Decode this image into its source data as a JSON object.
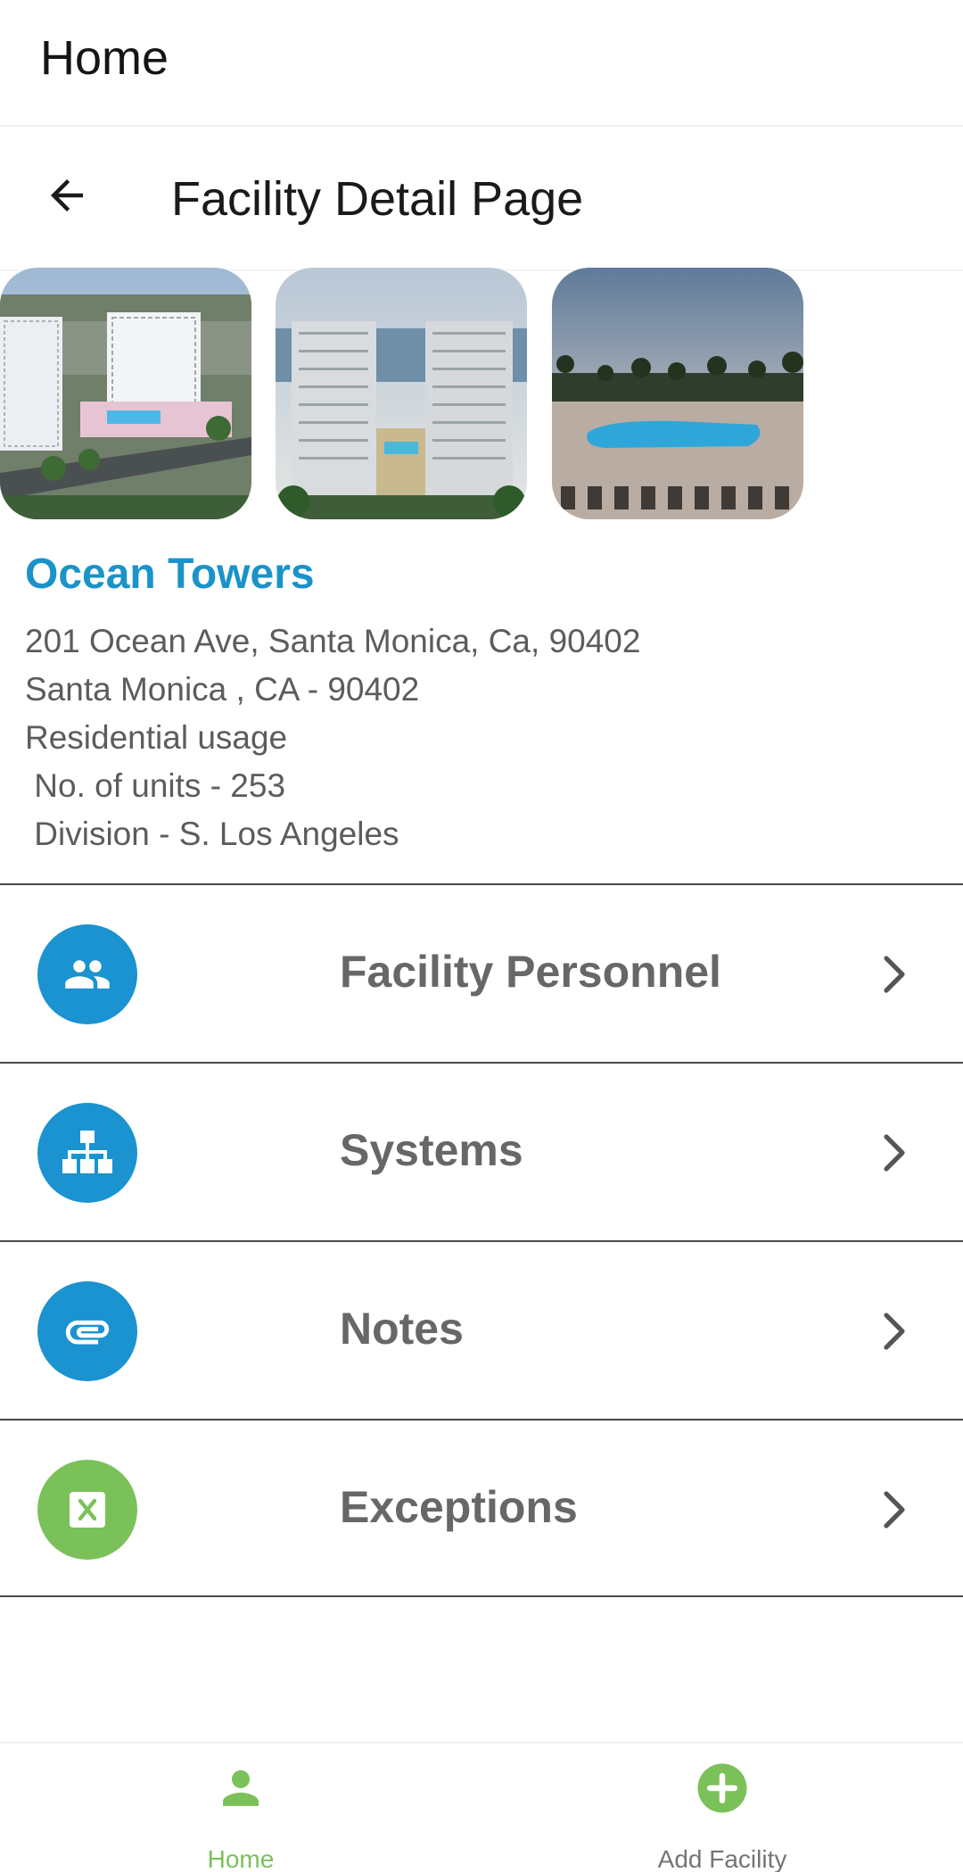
{
  "appbar": {
    "title": "Home"
  },
  "page": {
    "title": "Facility Detail Page",
    "back_icon": "arrow-left-icon"
  },
  "gallery": {
    "images": [
      {
        "name": "aerial-towers-photo"
      },
      {
        "name": "towers-ocean-view-photo"
      },
      {
        "name": "pool-sunset-photo"
      }
    ]
  },
  "facility": {
    "name": "Ocean Towers",
    "address": "201 Ocean Ave, Santa Monica, Ca, 90402",
    "city_line": "Santa Monica , CA - 90402",
    "usage": "Residential usage",
    "units": " No. of units - 253",
    "division": " Division - S. Los Angeles"
  },
  "menu": {
    "items": [
      {
        "label": "Facility Personnel",
        "icon": "people-icon",
        "color": "#1a93d0"
      },
      {
        "label": "Systems",
        "icon": "org-chart-icon",
        "color": "#1a93d0"
      },
      {
        "label": "Notes",
        "icon": "paperclip-icon",
        "color": "#1a93d0"
      },
      {
        "label": "Exceptions",
        "icon": "excel-icon",
        "color": "#7bc15a"
      }
    ]
  },
  "bottom_nav": {
    "items": [
      {
        "label": "Home",
        "icon": "person-icon",
        "active": true,
        "color": "#7bc15a"
      },
      {
        "label": "Add Facility",
        "icon": "add-circle-icon",
        "active": false,
        "color": "#7bc15a"
      }
    ]
  },
  "colors": {
    "accent_blue": "#1a93c9",
    "accent_green": "#7bc15a",
    "text_gray": "#5c5c5c"
  }
}
